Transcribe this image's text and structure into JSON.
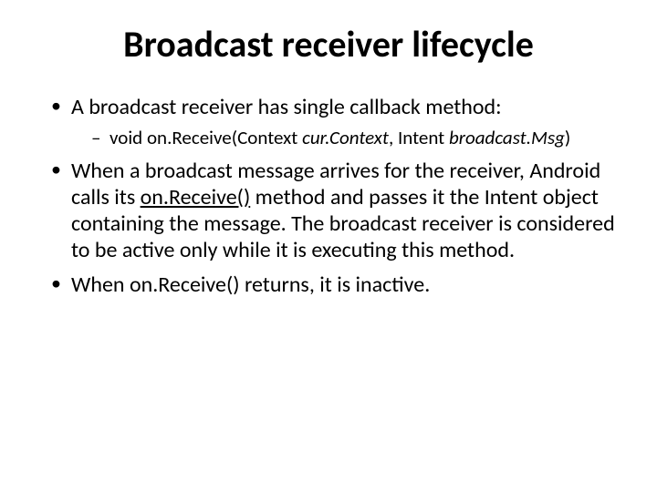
{
  "title": "Broadcast receiver lifecycle",
  "bullets": {
    "b1": "A broadcast receiver has single callback method:",
    "b1_sub_prefix": "void on.Receive(Context ",
    "b1_sub_arg1": "cur.Context",
    "b1_sub_mid": ", Intent ",
    "b1_sub_arg2": "broadcast.Msg",
    "b1_sub_suffix": ")",
    "b2_pre": "When a broadcast message arrives for the receiver, Android calls its ",
    "b2_link": "on.Receive()",
    "b2_post": " method and passes it the Intent object containing the message. The broadcast receiver is considered to be active only while it is executing this method.",
    "b3": "When on.Receive() returns, it is inactive."
  }
}
